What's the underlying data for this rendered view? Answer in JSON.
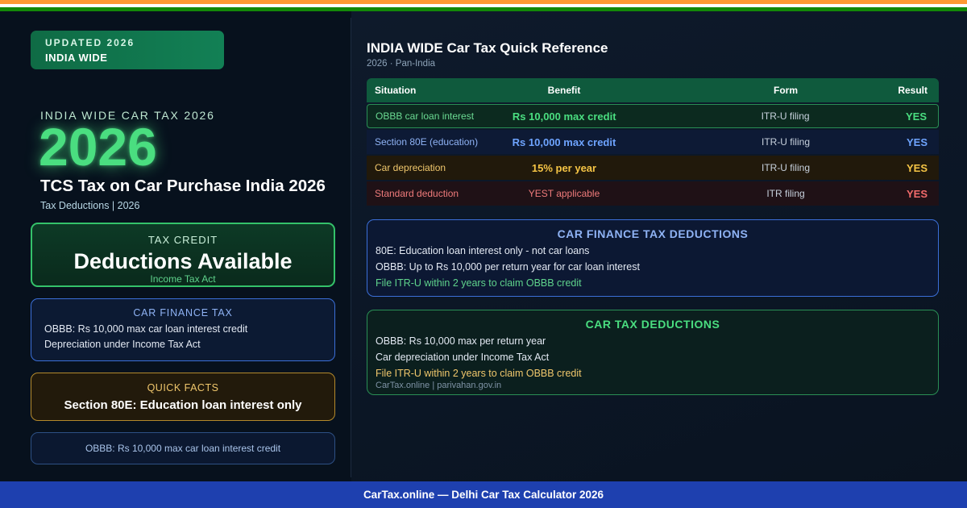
{
  "badge": {
    "line1": "UPDATED 2026",
    "line2": "INDIA WIDE"
  },
  "hero": {
    "kicker": "INDIA WIDE CAR TAX 2026",
    "year": "2026",
    "title": "TCS Tax on Car Purchase India 2026",
    "subtitle": "Tax Deductions | 2026"
  },
  "tax_credit": {
    "label": "TAX CREDIT",
    "value": "Deductions Available",
    "note": "Income Tax Act"
  },
  "car_finance_tax": {
    "title": "CAR FINANCE TAX",
    "lines": [
      "OBBB: Rs 10,000 max car loan interest credit",
      "Depreciation under Income Tax Act"
    ]
  },
  "quick_facts": {
    "title": "QUICK FACTS",
    "value": "Section 80E: Education loan interest only"
  },
  "obbb_pill": "OBBB: Rs 10,000 max car loan interest credit",
  "reference": {
    "title": "INDIA WIDE Car Tax Quick Reference",
    "subtitle": "2026 · Pan-India",
    "headers": [
      "Situation",
      "Benefit",
      "Form",
      "Result"
    ],
    "rows": [
      {
        "situation": "OBBB car loan interest",
        "benefit": "Rs 10,000 max credit",
        "form": "ITR-U filing",
        "result": "YES"
      },
      {
        "situation": "Section 80E (education)",
        "benefit": "Rs 10,000 max credit",
        "form": "ITR-U filing",
        "result": "YES"
      },
      {
        "situation": "Car depreciation",
        "benefit": "15% per year",
        "form": "ITR-U filing",
        "result": "YES"
      },
      {
        "situation": "Standard deduction",
        "benefit": "YEST applicable",
        "form": "ITR filing",
        "result": "YES"
      }
    ]
  },
  "car_finance_deductions": {
    "title": "CAR FINANCE TAX DEDUCTIONS",
    "lines": [
      "80E: Education loan interest only - not car loans",
      "OBBB: Up to Rs 10,000 per return year for car loan interest",
      "File ITR-U within 2 years to claim OBBB credit"
    ]
  },
  "car_tax_deductions": {
    "title": "CAR TAX DEDUCTIONS",
    "lines": [
      "OBBB: Rs 10,000 max per return year",
      "Car depreciation under Income Tax Act",
      "File ITR-U within 2 years to claim OBBB credit"
    ],
    "source": "CarTax.online | parivahan.gov.in"
  },
  "footer": "CarTax.online — Delhi Car Tax Calculator 2026",
  "colors": {
    "flag_saffron": "#ff9933",
    "flag_white": "#ffffff",
    "flag_green": "#138808",
    "accent_green": "#4ade80",
    "accent_blue": "#6ea4ff",
    "accent_gold": "#f5c445",
    "accent_red": "#f26b6b",
    "footer_bg": "#1e40af"
  }
}
